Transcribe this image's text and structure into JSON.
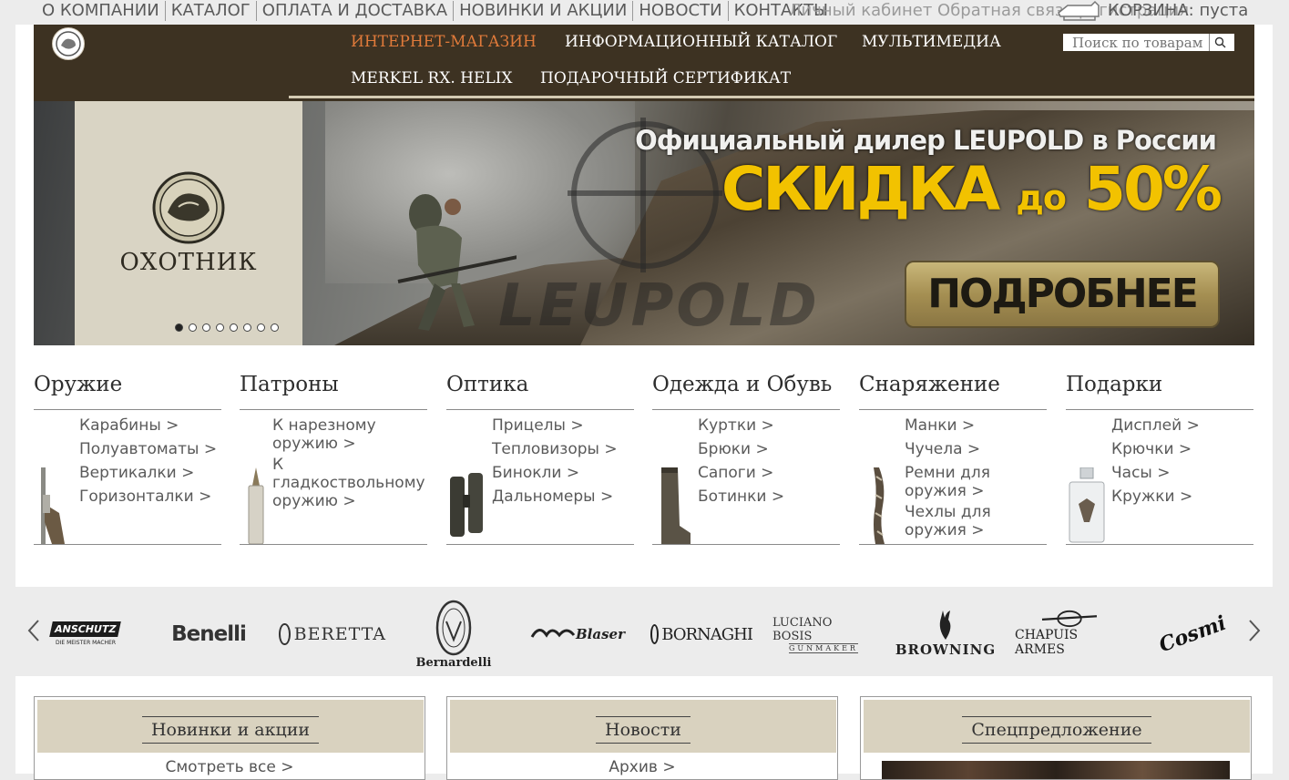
{
  "topnav": {
    "links": [
      "О КОМПАНИИ",
      "КАТАЛОГ",
      "ОПЛАТА И ДОСТАВКА",
      "НОВИНКИ И АКЦИИ",
      "НОВОСТИ",
      "КОНТАКТЫ"
    ],
    "account_text": "Личный кабинет  Обратная связь  регистрация",
    "cart_text": "КОРЗИНА: пуста"
  },
  "header": {
    "nav": [
      "ИНТЕРНЕТ-МАГАЗИН",
      "ИНФОРМАЦИОННЫЙ КАТАЛОГ",
      "МУЛЬТИМЕДИА",
      "MERKEL RX. HELIX",
      "ПОДАРОЧНЫЙ СЕРТИФИКАТ"
    ],
    "active_index": 0,
    "search_placeholder": "Поиск по товарам"
  },
  "banner": {
    "logo_name": "ОХОТНИК",
    "headline": "Официальный дилер LEUPOLD в России",
    "sale_main": "СКИДКА",
    "sale_small": "до",
    "sale_value": "50%",
    "button": "ПОДРОБНЕЕ",
    "watermark": "LEUPOLD",
    "slides": 8,
    "active_slide": 0
  },
  "categories": [
    {
      "title": "Оружие",
      "links": [
        "Карабины >",
        "Полуавтоматы >",
        "Вертикалки >",
        "Горизонталки >"
      ]
    },
    {
      "title": "Патроны",
      "links": [
        "К нарезному оружию >",
        "К гладкоствольному оружию >"
      ]
    },
    {
      "title": "Оптика",
      "links": [
        "Прицелы >",
        "Тепловизоры >",
        "Бинокли >",
        "Дальномеры >"
      ]
    },
    {
      "title": "Одежда и Обувь",
      "links": [
        "Куртки >",
        "Брюки >",
        "Сапоги >",
        "Ботинки >"
      ]
    },
    {
      "title": "Снаряжение",
      "links": [
        "Манки >",
        "Чучела >",
        "Ремни для оружия >",
        "Чехлы для оружия >"
      ]
    },
    {
      "title": "Подарки",
      "links": [
        "Дисплей >",
        "Крючки >",
        "Часы >",
        "Кружки >"
      ]
    }
  ],
  "brands": [
    "ANSCHUTZ",
    "DIE MEISTER MACHER",
    "Benelli",
    "BERETTA",
    "Bernardelli",
    "Blaser",
    "BORNAGHI",
    "LUCIANO BOSIS",
    "GUNMAKER",
    "BROWNING",
    "CHAPUIS ARMES",
    "Cosmi"
  ],
  "boxes": [
    {
      "title": "Новинки и акции",
      "link": "Смотреть все >"
    },
    {
      "title": "Новости",
      "link": "Архив >"
    },
    {
      "title": "Спецпредложение",
      "link": ""
    }
  ],
  "colors": {
    "header_bg": "#3d3222",
    "active_nav": "#e07a3a",
    "sale_yellow": "#f2c200",
    "beige": "#d9d2bf"
  }
}
